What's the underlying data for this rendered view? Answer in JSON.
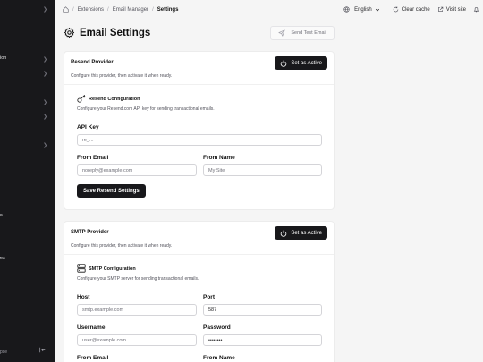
{
  "sidebar": {
    "chevron_icon": "chevron-right-icon",
    "items": [
      {
        "label": "ion"
      },
      {
        "label": "s"
      },
      {
        "label": "es"
      }
    ],
    "footer_label": "pse"
  },
  "breadcrumb": {
    "items": [
      "Extensions",
      "Email Manager"
    ],
    "current": "Settings"
  },
  "topbar": {
    "language": "English",
    "clear_cache": "Clear cache",
    "visit_site": "Visit site"
  },
  "page": {
    "title": "Email Settings",
    "send_test_label": "Send Test Email"
  },
  "resend": {
    "title": "Resend Provider",
    "description": "Configure this provider, then activate it when ready.",
    "activate_label": "Set as Active",
    "config_title": "Resend Configuration",
    "config_desc": "Configure your Resend.com API key for sending transactional emails.",
    "api_key_label": "API Key",
    "api_key_placeholder": "re_...",
    "from_email_label": "From Email",
    "from_email_placeholder": "noreply@example.com",
    "from_name_label": "From Name",
    "from_name_placeholder": "My Site",
    "save_label": "Save Resend Settings"
  },
  "smtp": {
    "title": "SMTP Provider",
    "description": "Configure this provider, then activate it when ready.",
    "activate_label": "Set as Active",
    "config_title": "SMTP Configuration",
    "config_desc": "Configure your SMTP server for sending transactional emails.",
    "host_label": "Host",
    "host_placeholder": "smtp.example.com",
    "port_label": "Port",
    "port_value": "587",
    "username_label": "Username",
    "username_placeholder": "user@example.com",
    "password_label": "Password",
    "password_value": "••••••••",
    "from_email_label": "From Email",
    "from_name_label": "From Name"
  }
}
